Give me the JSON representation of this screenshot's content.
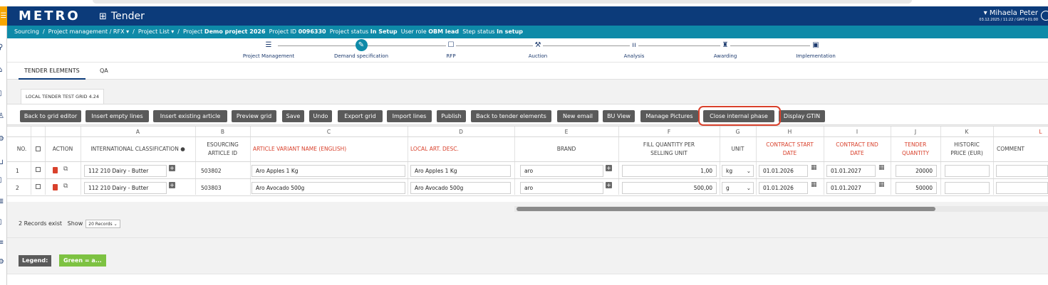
{
  "app": {
    "logo": "METRO",
    "title": "Tender",
    "user_name": "Mihaela Peter",
    "user_datetime": "03.12.2025 / 11:22 / GMT+01:00"
  },
  "breadcrumb": {
    "items": [
      "Sourcing",
      "Project management / RFX ▾",
      "Project List ▾"
    ],
    "project_label": "Project",
    "project_name": "Demo project 2026",
    "project_id_label": "Project ID",
    "project_id": "0096330",
    "project_status_label": "Project status",
    "project_status": "In Setup",
    "user_role_label": "User role",
    "user_role": "OBM lead",
    "step_status_label": "Step status",
    "step_status": "In setup"
  },
  "steps": [
    {
      "label": "Project Management",
      "icon": "list-icon",
      "glyph": "☰"
    },
    {
      "label": "Demand specification",
      "icon": "pencil-icon",
      "glyph": "✎"
    },
    {
      "label": "RFP",
      "icon": "document-icon",
      "glyph": "☐"
    },
    {
      "label": "Auction",
      "icon": "gavel-icon",
      "glyph": "⚒"
    },
    {
      "label": "Analysis",
      "icon": "chart-icon",
      "glyph": "ıı"
    },
    {
      "label": "Awarding",
      "icon": "award-icon",
      "glyph": "♜"
    },
    {
      "label": "Implementation",
      "icon": "box-icon",
      "glyph": "▣"
    }
  ],
  "tabs": [
    {
      "label": "TENDER ELEMENTS"
    },
    {
      "label": "QA"
    }
  ],
  "grid_tab": "LOCAL TENDER TEST GRID 4.24",
  "toolbar": [
    "Back to grid editor",
    "Insert empty lines",
    "Insert existing article",
    "Preview grid",
    "Save",
    "Undo",
    "Export grid",
    "Import lines",
    "Publish",
    "Back to tender elements",
    "New email",
    "BU View",
    "Manage Pictures",
    "Close internal phase",
    "Display GTIN"
  ],
  "columns": {
    "letters": [
      "A",
      "B",
      "C",
      "D",
      "E",
      "F",
      "G",
      "H",
      "I",
      "J",
      "K",
      "L"
    ],
    "headers": {
      "no": "NO.",
      "action": "ACTION",
      "classification": "INTERNATIONAL CLASSIFICATION",
      "esourcing": "ESOURCING ARTICLE ID",
      "variant": "ARTICLE VARIANT NAME (ENGLISH)",
      "local": "LOCAL ART. DESC.",
      "brand": "BRAND",
      "fill": "FILL QUANTITY PER SELLING UNIT",
      "unit": "UNIT",
      "start": "CONTRACT START DATE",
      "end": "CONTRACT END DATE",
      "qty": "TENDER QUANTITY",
      "hist": "HISTORIC PRICE (EUR)",
      "comment": "COMMENT"
    }
  },
  "rows": [
    {
      "no": "1",
      "classification": "112 210 Dairy - Butter",
      "esourcing": "503802",
      "variant": "Aro Apples 1 Kg",
      "local": "Aro Apples 1 Kg",
      "brand": "aro",
      "fill": "1,00",
      "unit": "kg",
      "start": "01.01.2026",
      "end": "01.01.2027",
      "qty": "20000"
    },
    {
      "no": "2",
      "classification": "112 210 Dairy - Butter",
      "esourcing": "503803",
      "variant": "Aro Avocado 500g",
      "local": "Aro Avocado 500g",
      "brand": "aro",
      "fill": "500,00",
      "unit": "g",
      "start": "01.01.2026",
      "end": "01.01.2027",
      "qty": "50000"
    }
  ],
  "footer": {
    "records": "2 Records exist",
    "show_label": "Show",
    "show_value": "20 Records",
    "legend_label": "Legend:",
    "legend_green": "Green = a..."
  }
}
